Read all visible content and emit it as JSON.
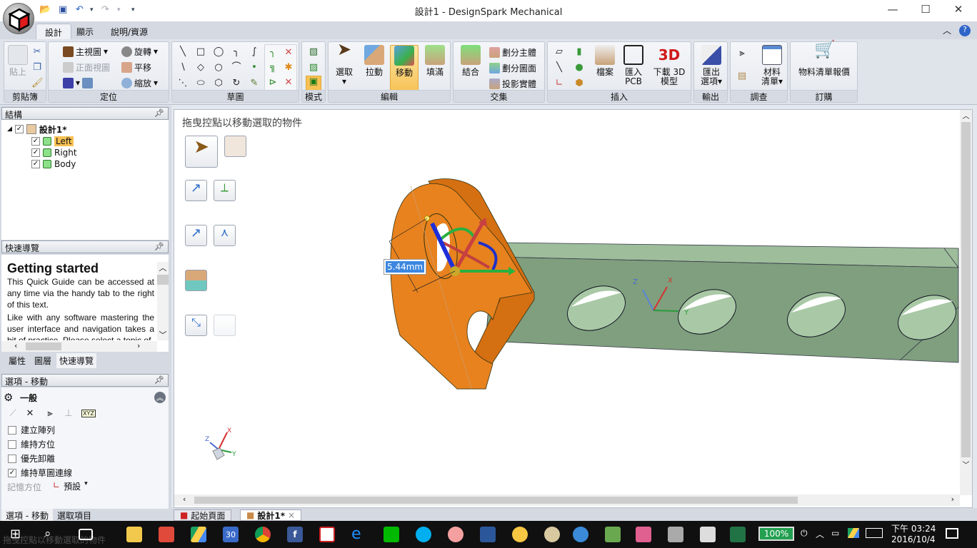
{
  "window": {
    "title": "設計1 - DesignSpark Mechanical",
    "minimize": "—",
    "maximize": "☐",
    "close": "✕"
  },
  "qat": {
    "open": "open-folder",
    "save": "save",
    "undo": "↶",
    "redo": "↷",
    "dropdown": "▾"
  },
  "ribbon_tabs": [
    {
      "label": "設計",
      "active": true
    },
    {
      "label": "顯示"
    },
    {
      "label": "說明/資源"
    }
  ],
  "ribbon_right": {
    "collapse": "︿",
    "help": "?"
  },
  "groups": {
    "clipboard": {
      "label": "剪貼簿",
      "paste": "貼上"
    },
    "orient": {
      "label": "定位",
      "home": "主視圖",
      "front": "正面視圖",
      "spin": "旋轉",
      "pan": "平移",
      "zoom": "縮放"
    },
    "sketch": {
      "label": "草圖"
    },
    "mode": {
      "label": "模式"
    },
    "edit": {
      "label": "編輯",
      "select": "選取",
      "pull": "拉動",
      "move": "移動",
      "fill": "填滿"
    },
    "intersect": {
      "label": "交集",
      "combine": "結合",
      "split_body": "劃分主體",
      "split_face": "劃分圖面",
      "project": "投影實體"
    },
    "insert": {
      "label": "插入",
      "file": "檔案",
      "pcb": "匯入\nPCB",
      "pcb1": "匯入",
      "pcb2": "PCB",
      "download1": "下載 3D",
      "download2": "模型",
      "logo3d": "3D"
    },
    "output": {
      "label": "輸出",
      "export1": "匯出",
      "export2": "選項▾"
    },
    "investigate": {
      "label": "調查",
      "bom1": "材料",
      "bom2": "清單▾"
    },
    "order": {
      "label": "訂購",
      "quote": "物料清單報價"
    }
  },
  "structure": {
    "title": "結構",
    "root": "設計1*",
    "items": [
      {
        "label": "Left",
        "selected": true
      },
      {
        "label": "Right"
      },
      {
        "label": "Body"
      }
    ]
  },
  "quickguide": {
    "title": "快速導覽",
    "heading": "Getting started",
    "p1": "This Quick Guide can be accessed at any time via the handy tab to the right of this text.",
    "p2": "Like with any software mastering the user interface and navigation takes a bit of practice. Please select a topic of",
    "tabs": [
      "屬性",
      "圖層",
      "快速導覽"
    ],
    "active_tab": "快速導覽"
  },
  "options": {
    "title": "選項 - 移動",
    "section": "一般",
    "xyz": "XYZ",
    "checks": [
      {
        "label": "建立陣列",
        "checked": false
      },
      {
        "label": "維持方位",
        "checked": false
      },
      {
        "label": "優先卸離",
        "checked": false
      },
      {
        "label": "維持草圖連線",
        "checked": true
      }
    ],
    "orient_label": "記憶方位",
    "orient_value": "預設",
    "tabs": [
      "選項 - 移動",
      "選取項目"
    ]
  },
  "viewport": {
    "hint": "拖曳控點以移動選取的物件",
    "dimension": "5.44mm",
    "axes": {
      "x": "X",
      "y": "Y",
      "z": "Z"
    },
    "colors": {
      "part_orange": "#e8821e",
      "body_green": "#7f9f7e",
      "selection_blue": "#3d87e0"
    }
  },
  "doc_tabs": [
    {
      "label": "起始頁面"
    },
    {
      "label": "設計1*",
      "active": true,
      "close": "×"
    }
  ],
  "status": {
    "text": "拖曳控點以移動選取的物件"
  },
  "taskbar": {
    "battery": "100%",
    "time": "下午 03:24",
    "date": "2016/10/4",
    "calendar_day": "30",
    "icons": [
      "start",
      "search",
      "task-view",
      "file-explorer",
      "gmail",
      "google-drive",
      "calendar",
      "chrome",
      "facebook",
      "designspark",
      "internet-explorer",
      "line",
      "skype",
      "app",
      "word",
      "keep",
      "paint",
      "app2",
      "app3",
      "app4",
      "app5",
      "app6",
      "excel"
    ]
  }
}
